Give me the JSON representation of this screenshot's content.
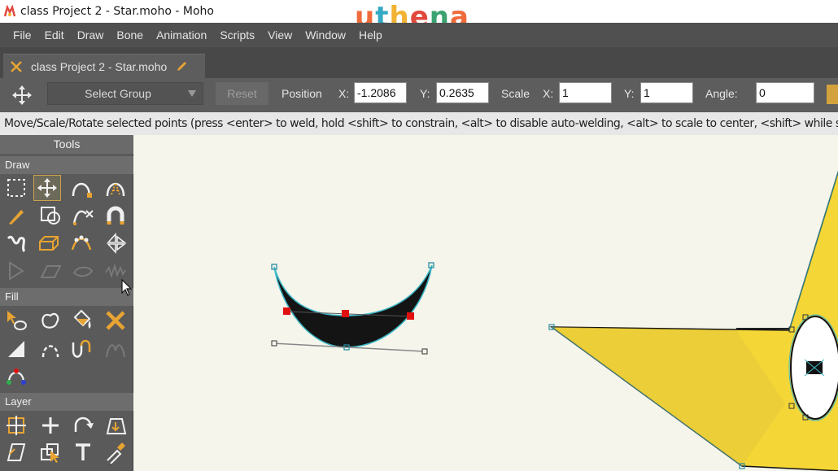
{
  "window": {
    "title": "class Project 2 - Star.moho - Moho",
    "app_icon": "moho-app-icon"
  },
  "watermark": {
    "text": "uthena",
    "letters": [
      "u",
      "t",
      "h",
      "e",
      "n",
      "a"
    ]
  },
  "menu": {
    "items": [
      "File",
      "Edit",
      "Draw",
      "Bone",
      "Animation",
      "Scripts",
      "View",
      "Window",
      "Help"
    ]
  },
  "document_tab": {
    "label": "class Project 2 - Star.moho",
    "close_icon": "close-icon",
    "modified_icon": "pencil-icon"
  },
  "tool_options": {
    "tool_icon": "move-arrows-icon",
    "select_group": "Select Group",
    "reset_label": "Reset",
    "position_label": "Position",
    "x_label": "X:",
    "position_x": "-1.2086",
    "y_label": "Y:",
    "position_y": "0.2635",
    "scale_label": "Scale",
    "scale_x_label": "X:",
    "scale_x": "1",
    "scale_y_label": "Y:",
    "scale_y": "1",
    "angle_label": "Angle:",
    "angle": "0"
  },
  "status": {
    "text": "Move/Scale/Rotate selected points (press <enter> to weld, hold <shift> to constrain, <alt> to disable auto-welding, <alt> to scale to center, <shift> while scaling"
  },
  "tools_panel": {
    "title": "Tools",
    "sections": {
      "draw": "Draw",
      "fill": "Fill",
      "layer": "Layer"
    },
    "draw_tools": [
      "select-points-icon",
      "transform-points-icon",
      "add-point-icon",
      "curvature-icon",
      "freehand-icon",
      "draw-shape-icon",
      "delete-edge-icon",
      "magnet-icon",
      "blob-brush-icon",
      "perspective-icon",
      "bend-icon",
      "noise-icon",
      "shear-icon",
      "perspective-h-icon",
      "curve-profile-icon",
      "wave-icon"
    ],
    "fill_tools": [
      "select-shape-icon",
      "create-shape-icon",
      "paint-bucket-icon",
      "delete-shape-icon",
      "line-width-icon",
      "hide-edge-icon",
      "stroke-exposure-icon",
      "curve-exposure-icon",
      "color-points-icon"
    ],
    "layer_tools": [
      "translate-layer-icon",
      "scale-layer-icon",
      "rotate-layer-icon",
      "set-origin-icon",
      "shear-layer-icon",
      "switch-layer-icon",
      "text-icon",
      "eyedropper-icon"
    ]
  },
  "colors": {
    "accent": "#c9a24b",
    "panel": "#5a5a5a",
    "canvas": "#f5f5ec",
    "star_fill": "#f7dc3f",
    "selection": "#3fb9c8",
    "selected_point": "#e01010",
    "shape_fill": "#141414"
  }
}
